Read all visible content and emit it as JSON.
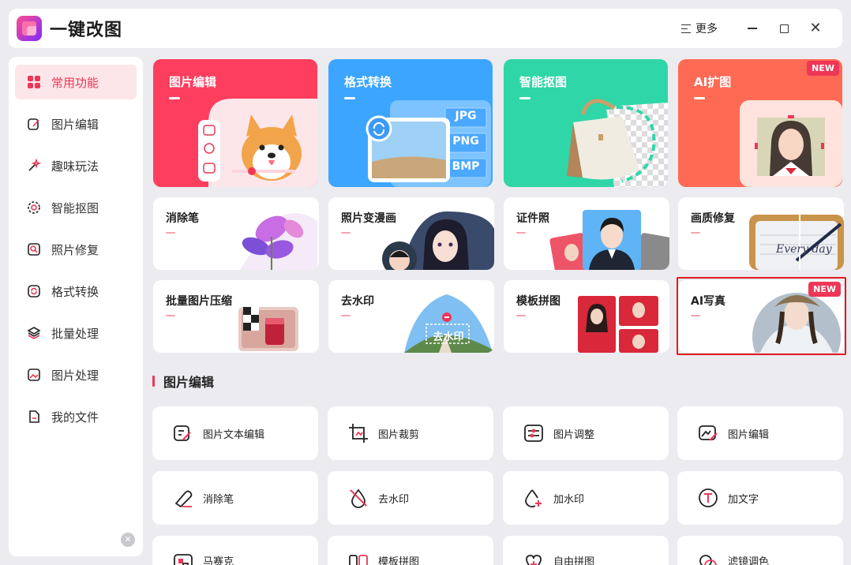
{
  "app": {
    "title": "一键改图"
  },
  "titlebar": {
    "more_label": "更多"
  },
  "sidebar": {
    "items": [
      {
        "label": "常用功能",
        "icon": "grid-icon",
        "active": true
      },
      {
        "label": "图片编辑",
        "icon": "edit-icon"
      },
      {
        "label": "趣味玩法",
        "icon": "magic-wand-icon"
      },
      {
        "label": "智能抠图",
        "icon": "cutout-icon"
      },
      {
        "label": "照片修复",
        "icon": "photo-repair-icon"
      },
      {
        "label": "格式转换",
        "icon": "convert-icon"
      },
      {
        "label": "批量处理",
        "icon": "layers-icon"
      },
      {
        "label": "图片处理",
        "icon": "image-icon"
      },
      {
        "label": "我的文件",
        "icon": "file-icon"
      }
    ]
  },
  "features": {
    "big": [
      {
        "title": "图片编辑",
        "color": "#fd3e5e"
      },
      {
        "title": "格式转换",
        "color": "#3ca5ff",
        "formats": [
          "JPG",
          "PNG",
          "BMP"
        ]
      },
      {
        "title": "智能抠图",
        "color": "#2fd6a8"
      },
      {
        "title": "AI扩图",
        "color": "#ff6a55",
        "badge": "NEW"
      }
    ],
    "row2": [
      {
        "title": "消除笔"
      },
      {
        "title": "照片变漫画"
      },
      {
        "title": "证件照"
      },
      {
        "title": "画质修复",
        "image_text": "Every day"
      }
    ],
    "row3": [
      {
        "title": "批量图片压缩"
      },
      {
        "title": "去水印",
        "image_text": "去水印"
      },
      {
        "title": "模板拼图"
      },
      {
        "title": "AI写真",
        "badge": "NEW"
      }
    ]
  },
  "section": {
    "title": "图片编辑"
  },
  "tools": [
    {
      "label": "图片文本编辑",
      "icon": "text-edit-icon"
    },
    {
      "label": "图片裁剪",
      "icon": "crop-icon"
    },
    {
      "label": "图片调整",
      "icon": "adjust-icon"
    },
    {
      "label": "图片编辑",
      "icon": "image-edit-icon"
    },
    {
      "label": "消除笔",
      "icon": "eraser-icon"
    },
    {
      "label": "去水印",
      "icon": "remove-watermark-icon"
    },
    {
      "label": "加水印",
      "icon": "add-watermark-icon"
    },
    {
      "label": "加文字",
      "icon": "add-text-icon"
    },
    {
      "label": "马赛克",
      "icon": "mosaic-icon"
    },
    {
      "label": "模板拼图",
      "icon": "template-collage-icon"
    },
    {
      "label": "自由拼图",
      "icon": "free-collage-icon"
    },
    {
      "label": "滤镜调色",
      "icon": "filter-icon"
    }
  ]
}
